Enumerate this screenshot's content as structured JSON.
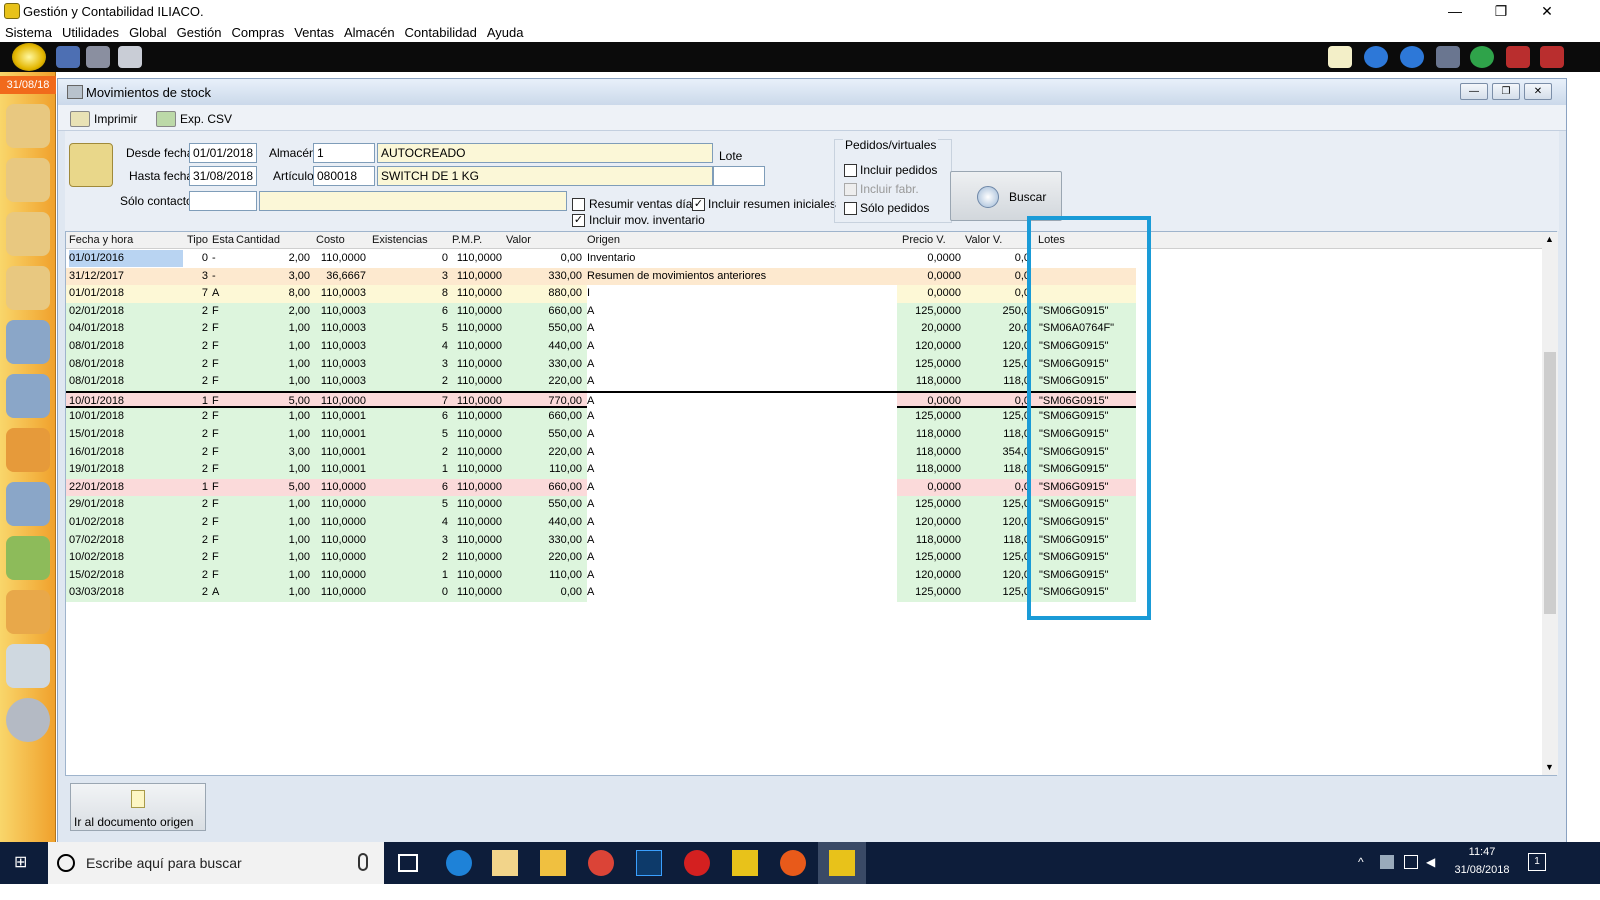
{
  "app": {
    "title": "Gestión y Contabilidad ILIACO."
  },
  "window_controls": {
    "minimize": "—",
    "maximize": "❐",
    "close": "✕"
  },
  "menu": [
    "Sistema",
    "Utilidades",
    "Global",
    "Gestión",
    "Compras",
    "Ventas",
    "Almacén",
    "Contabilidad",
    "Ayuda"
  ],
  "sidebar": {
    "date": "31/08/18"
  },
  "window": {
    "title": "Movimientos de stock",
    "toolbar": {
      "print": "Imprimir",
      "export": "Exp. CSV"
    }
  },
  "filters": {
    "desde_fecha_label": "Desde fecha",
    "desde_fecha": "01/01/2018",
    "hasta_fecha_label": "Hasta fecha",
    "hasta_fecha": "31/08/2018",
    "almacen_label": "Almacén",
    "almacen_code": "1",
    "almacen_name": "AUTOCREADO",
    "articulo_label": "Artículo",
    "articulo_code": "080018",
    "articulo_name": "SWITCH DE 1 KG",
    "lote_label": "Lote",
    "lote": "",
    "solo_contacto_label": "Sólo contacto",
    "resumir_ventas": "Resumir ventas día",
    "incluir_resumen": "Incluir resumen iniciales",
    "incluir_mov_inv": "Incluir mov. inventario",
    "pedidos_group": "Pedidos/virtuales",
    "incluir_pedidos": "Incluir pedidos",
    "incluir_fabr": "Incluir fabr.",
    "solo_pedidos": "Sólo pedidos",
    "buscar": "Buscar"
  },
  "table": {
    "headers": [
      "Fecha y hora",
      "Tipo",
      "Esta",
      "Cantidad",
      "Costo",
      "Existencias",
      "P.M.P.",
      "Valor",
      "Origen",
      "Precio V.",
      "Valor V.",
      "Lotes"
    ],
    "rows": [
      {
        "fecha": "01/01/2016",
        "tipo": "0",
        "estado": "-",
        "cantidad": "2,00",
        "costo": "110,0000",
        "existencias": "0",
        "pmp": "110,0000",
        "valor": "0,00",
        "origen": "Inventario",
        "precio_v": "0,0000",
        "valor_v": "0,0",
        "lotes": "",
        "color": "#ffffff"
      },
      {
        "fecha": "31/12/2017",
        "tipo": "3",
        "estado": "-",
        "cantidad": "3,00",
        "costo": "36,6667",
        "existencias": "3",
        "pmp": "110,0000",
        "valor": "330,00",
        "origen": "Resumen de movimientos anteriores",
        "precio_v": "0,0000",
        "valor_v": "0,0",
        "lotes": "",
        "color": "#fde9cf"
      },
      {
        "fecha": "01/01/2018",
        "tipo": "7",
        "estado": "A",
        "cantidad": "8,00",
        "costo": "110,0003",
        "existencias": "8",
        "pmp": "110,0000",
        "valor": "880,00",
        "origen": "I",
        "precio_v": "0,0000",
        "valor_v": "0,0",
        "lotes": "",
        "color": "#fdf8d6"
      },
      {
        "fecha": "02/01/2018",
        "tipo": "2",
        "estado": "F",
        "cantidad": "2,00",
        "costo": "110,0003",
        "existencias": "6",
        "pmp": "110,0000",
        "valor": "660,00",
        "origen": "A",
        "precio_v": "125,0000",
        "valor_v": "250,0",
        "lotes": "\"SM06G0915\"",
        "color": "#ddf5dd"
      },
      {
        "fecha": "04/01/2018",
        "tipo": "2",
        "estado": "F",
        "cantidad": "1,00",
        "costo": "110,0003",
        "existencias": "5",
        "pmp": "110,0000",
        "valor": "550,00",
        "origen": "A",
        "precio_v": "20,0000",
        "valor_v": "20,0",
        "lotes": "\"SM06A0764F\"",
        "color": "#ddf5dd"
      },
      {
        "fecha": "08/01/2018",
        "tipo": "2",
        "estado": "F",
        "cantidad": "1,00",
        "costo": "110,0003",
        "existencias": "4",
        "pmp": "110,0000",
        "valor": "440,00",
        "origen": "A",
        "precio_v": "120,0000",
        "valor_v": "120,0",
        "lotes": "\"SM06G0915\"",
        "color": "#ddf5dd"
      },
      {
        "fecha": "08/01/2018",
        "tipo": "2",
        "estado": "F",
        "cantidad": "1,00",
        "costo": "110,0003",
        "existencias": "3",
        "pmp": "110,0000",
        "valor": "330,00",
        "origen": "A",
        "precio_v": "125,0000",
        "valor_v": "125,0",
        "lotes": "\"SM06G0915\"",
        "color": "#ddf5dd"
      },
      {
        "fecha": "08/01/2018",
        "tipo": "2",
        "estado": "F",
        "cantidad": "1,00",
        "costo": "110,0003",
        "existencias": "2",
        "pmp": "110,0000",
        "valor": "220,00",
        "origen": "A",
        "precio_v": "118,0000",
        "valor_v": "118,0",
        "lotes": "\"SM06G0915\"",
        "color": "#ddf5dd"
      },
      {
        "fecha": "10/01/2018",
        "tipo": "1",
        "estado": "F",
        "cantidad": "5,00",
        "costo": "110,0000",
        "existencias": "7",
        "pmp": "110,0000",
        "valor": "770,00",
        "origen": "A",
        "precio_v": "0,0000",
        "valor_v": "0,0",
        "lotes": "\"SM06G0915\"",
        "color": "#fbdada",
        "selected": true
      },
      {
        "fecha": "10/01/2018",
        "tipo": "2",
        "estado": "F",
        "cantidad": "1,00",
        "costo": "110,0001",
        "existencias": "6",
        "pmp": "110,0000",
        "valor": "660,00",
        "origen": "A",
        "precio_v": "125,0000",
        "valor_v": "125,0",
        "lotes": "\"SM06G0915\"",
        "color": "#ddf5dd"
      },
      {
        "fecha": "15/01/2018",
        "tipo": "2",
        "estado": "F",
        "cantidad": "1,00",
        "costo": "110,0001",
        "existencias": "5",
        "pmp": "110,0000",
        "valor": "550,00",
        "origen": "A",
        "precio_v": "118,0000",
        "valor_v": "118,0",
        "lotes": "\"SM06G0915\"",
        "color": "#ddf5dd"
      },
      {
        "fecha": "16/01/2018",
        "tipo": "2",
        "estado": "F",
        "cantidad": "3,00",
        "costo": "110,0001",
        "existencias": "2",
        "pmp": "110,0000",
        "valor": "220,00",
        "origen": "A",
        "precio_v": "118,0000",
        "valor_v": "354,0",
        "lotes": "\"SM06G0915\"",
        "color": "#ddf5dd"
      },
      {
        "fecha": "19/01/2018",
        "tipo": "2",
        "estado": "F",
        "cantidad": "1,00",
        "costo": "110,0001",
        "existencias": "1",
        "pmp": "110,0000",
        "valor": "110,00",
        "origen": "A",
        "precio_v": "118,0000",
        "valor_v": "118,0",
        "lotes": "\"SM06G0915\"",
        "color": "#ddf5dd"
      },
      {
        "fecha": "22/01/2018",
        "tipo": "1",
        "estado": "F",
        "cantidad": "5,00",
        "costo": "110,0000",
        "existencias": "6",
        "pmp": "110,0000",
        "valor": "660,00",
        "origen": "A",
        "precio_v": "0,0000",
        "valor_v": "0,0",
        "lotes": "\"SM06G0915\"",
        "color": "#fbdada"
      },
      {
        "fecha": "29/01/2018",
        "tipo": "2",
        "estado": "F",
        "cantidad": "1,00",
        "costo": "110,0000",
        "existencias": "5",
        "pmp": "110,0000",
        "valor": "550,00",
        "origen": "A",
        "precio_v": "125,0000",
        "valor_v": "125,0",
        "lotes": "\"SM06G0915\"",
        "color": "#ddf5dd"
      },
      {
        "fecha": "01/02/2018",
        "tipo": "2",
        "estado": "F",
        "cantidad": "1,00",
        "costo": "110,0000",
        "existencias": "4",
        "pmp": "110,0000",
        "valor": "440,00",
        "origen": "A",
        "precio_v": "120,0000",
        "valor_v": "120,0",
        "lotes": "\"SM06G0915\"",
        "color": "#ddf5dd"
      },
      {
        "fecha": "07/02/2018",
        "tipo": "2",
        "estado": "F",
        "cantidad": "1,00",
        "costo": "110,0000",
        "existencias": "3",
        "pmp": "110,0000",
        "valor": "330,00",
        "origen": "A",
        "precio_v": "118,0000",
        "valor_v": "118,0",
        "lotes": "\"SM06G0915\"",
        "color": "#ddf5dd"
      },
      {
        "fecha": "10/02/2018",
        "tipo": "2",
        "estado": "F",
        "cantidad": "1,00",
        "costo": "110,0000",
        "existencias": "2",
        "pmp": "110,0000",
        "valor": "220,00",
        "origen": "A",
        "precio_v": "125,0000",
        "valor_v": "125,0",
        "lotes": "\"SM06G0915\"",
        "color": "#ddf5dd"
      },
      {
        "fecha": "15/02/2018",
        "tipo": "2",
        "estado": "F",
        "cantidad": "1,00",
        "costo": "110,0000",
        "existencias": "1",
        "pmp": "110,0000",
        "valor": "110,00",
        "origen": "A",
        "precio_v": "120,0000",
        "valor_v": "120,0",
        "lotes": "\"SM06G0915\"",
        "color": "#ddf5dd"
      },
      {
        "fecha": "03/03/2018",
        "tipo": "2",
        "estado": "A",
        "cantidad": "1,00",
        "costo": "110,0000",
        "existencias": "0",
        "pmp": "110,0000",
        "valor": "0,00",
        "origen": "A",
        "precio_v": "125,0000",
        "valor_v": "125,0",
        "lotes": "\"SM06G0915\"",
        "color": "#ddf5dd"
      }
    ]
  },
  "bottom": {
    "goto_origin": "Ir al documento origen"
  },
  "taskbar": {
    "search_placeholder": "Escribe aquí para buscar",
    "time": "11:47",
    "date": "31/08/2018",
    "notification_count": "1"
  },
  "colors": {
    "highlight_box": "#1a9bd7",
    "accent": "#f16a1b"
  }
}
